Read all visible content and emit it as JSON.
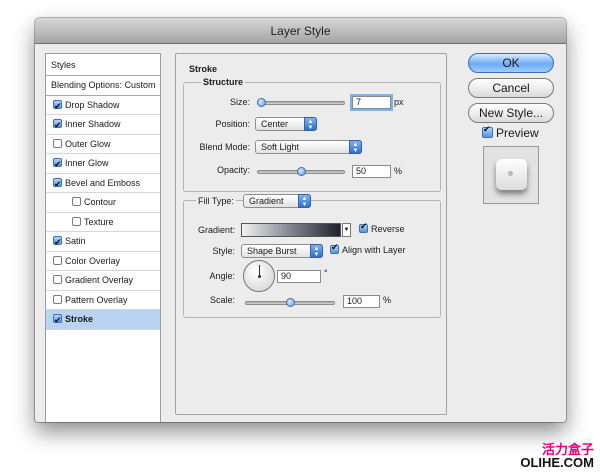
{
  "window": {
    "title": "Layer Style"
  },
  "styles_panel": {
    "header": "Styles",
    "blending_options": "Blending Options: Custom",
    "items": [
      {
        "label": "Drop Shadow",
        "checked": true,
        "sub": false,
        "selected": false
      },
      {
        "label": "Inner Shadow",
        "checked": true,
        "sub": false,
        "selected": false
      },
      {
        "label": "Outer Glow",
        "checked": false,
        "sub": false,
        "selected": false
      },
      {
        "label": "Inner Glow",
        "checked": true,
        "sub": false,
        "selected": false
      },
      {
        "label": "Bevel and Emboss",
        "checked": true,
        "sub": false,
        "selected": false
      },
      {
        "label": "Contour",
        "checked": false,
        "sub": true,
        "selected": false
      },
      {
        "label": "Texture",
        "checked": false,
        "sub": true,
        "selected": false
      },
      {
        "label": "Satin",
        "checked": true,
        "sub": false,
        "selected": false
      },
      {
        "label": "Color Overlay",
        "checked": false,
        "sub": false,
        "selected": false
      },
      {
        "label": "Gradient Overlay",
        "checked": false,
        "sub": false,
        "selected": false
      },
      {
        "label": "Pattern Overlay",
        "checked": false,
        "sub": false,
        "selected": false
      },
      {
        "label": "Stroke",
        "checked": true,
        "sub": false,
        "selected": true
      }
    ]
  },
  "stroke": {
    "section_title": "Stroke",
    "structure_title": "Structure",
    "size": {
      "label": "Size:",
      "value": "7",
      "unit": "px",
      "level": 0.03
    },
    "position": {
      "label": "Position:",
      "value": "Center"
    },
    "blend_mode": {
      "label": "Blend Mode:",
      "value": "Soft Light"
    },
    "opacity": {
      "label": "Opacity:",
      "value": "50",
      "unit": "%",
      "level": 0.5
    },
    "fill_type": {
      "label": "Fill Type:",
      "value": "Gradient"
    },
    "gradient": {
      "label": "Gradient:",
      "reverse_label": "Reverse",
      "reverse_checked": true
    },
    "style": {
      "label": "Style:",
      "value": "Shape Burst",
      "align_label": "Align with Layer",
      "align_checked": true
    },
    "angle": {
      "label": "Angle:",
      "value": "90",
      "unit": "°"
    },
    "scale": {
      "label": "Scale:",
      "value": "100",
      "unit": "%",
      "level": 0.5
    }
  },
  "buttons": {
    "ok": "OK",
    "cancel": "Cancel",
    "new_style": "New Style...",
    "preview_label": "Preview",
    "preview_checked": true
  },
  "watermark": {
    "line1": "活力盒子",
    "line2": "OLIHE.COM"
  },
  "colors": {
    "accent": "#4f93e4",
    "selected_row": "#b9d3f3",
    "watermark_pink": "#e6007e"
  }
}
